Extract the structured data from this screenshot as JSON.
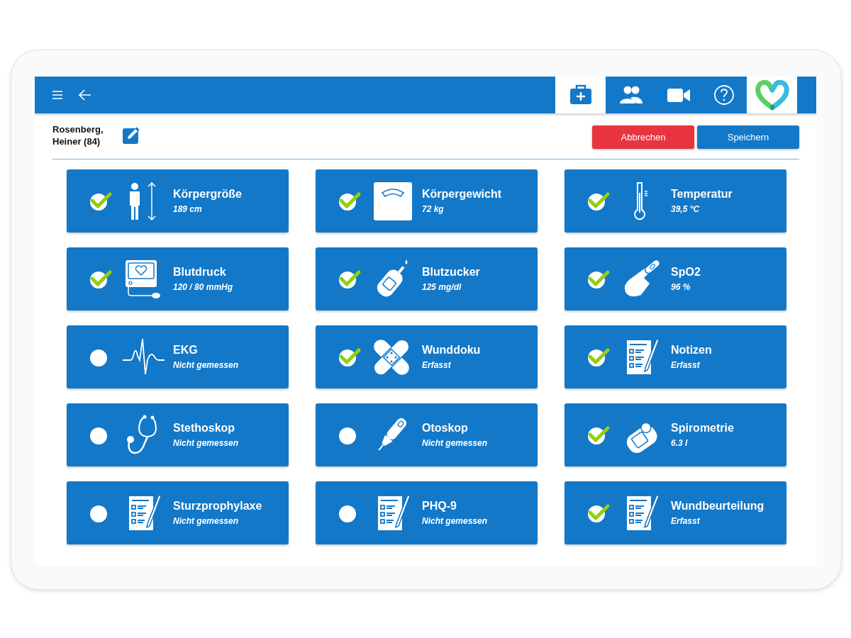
{
  "toolbar": {
    "tabs": [
      {
        "kind": "kit",
        "selected": true
      },
      {
        "kind": "people",
        "selected": false
      },
      {
        "kind": "video",
        "selected": false
      },
      {
        "kind": "help",
        "selected": false
      }
    ]
  },
  "patient": {
    "name": "Rosenberg, Heiner (84)"
  },
  "actions": [
    {
      "label": "Abbrechen",
      "kind": "danger"
    },
    {
      "label": "Speichern",
      "kind": "primary"
    }
  ],
  "measurements": [
    {
      "kind": "height",
      "title": "Körpergröße",
      "value": "189 cm",
      "done": true
    },
    {
      "kind": "scale",
      "title": "Körpergewicht",
      "value": "72 kg",
      "done": true
    },
    {
      "kind": "thermometer",
      "title": "Temperatur",
      "value": "39,5 °C",
      "done": true
    },
    {
      "kind": "pressure",
      "title": "Blutdruck",
      "value": "120 / 80 mmHg",
      "done": true
    },
    {
      "kind": "glucose",
      "title": "Blutzucker",
      "value": "125 mg/dl",
      "done": true
    },
    {
      "kind": "oximeter",
      "title": "SpO2",
      "value": "96 %",
      "done": true
    },
    {
      "kind": "ecg",
      "title": "EKG",
      "value": "Nicht gemessen",
      "done": false
    },
    {
      "kind": "bandage",
      "title": "Wunddoku",
      "value": "Erfasst",
      "done": true
    },
    {
      "kind": "form",
      "title": "Notizen",
      "value": "Erfasst",
      "done": true
    },
    {
      "kind": "stethoscope",
      "title": "Stethoskop",
      "value": "Nicht gemessen",
      "done": false
    },
    {
      "kind": "otoscope",
      "title": "Otoskop",
      "value": "Nicht gemessen",
      "done": false
    },
    {
      "kind": "spirometer",
      "title": "Spirometrie",
      "value": "6.3 l",
      "done": true
    },
    {
      "kind": "form",
      "title": "Sturzprophylaxe",
      "value": "Nicht gemessen",
      "done": false
    },
    {
      "kind": "form",
      "title": "PHQ-9",
      "value": "Nicht gemessen",
      "done": false
    },
    {
      "kind": "form",
      "title": "Wundbeurteilung",
      "value": "Erfasst",
      "done": true
    }
  ]
}
